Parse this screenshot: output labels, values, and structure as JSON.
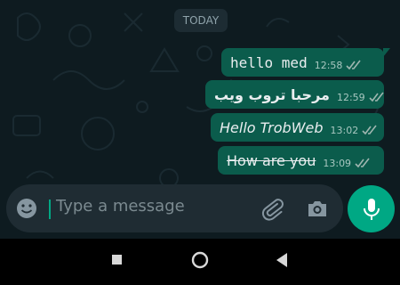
{
  "chat": {
    "date_chip": "TODAY",
    "messages": [
      {
        "text": "hello med",
        "time": "12:58",
        "status": "read-ticks-icon"
      },
      {
        "text": "مرحبا تروب ويب",
        "time": "12:59",
        "status": "read-ticks-icon"
      },
      {
        "text": "Hello TrobWeb",
        "time": "13:02",
        "status": "read-ticks-icon"
      },
      {
        "text": "How are you",
        "time": "13:09",
        "status": "read-ticks-icon"
      }
    ]
  },
  "composer": {
    "placeholder": "Type a message",
    "icons": [
      "emoji-icon",
      "paperclip-icon",
      "camera-icon",
      "microphone-icon"
    ]
  },
  "navbar": {
    "icons": [
      "recents-square-icon",
      "home-circle-icon",
      "back-triangle-icon"
    ]
  },
  "colors": {
    "chat_background": "#0e1b20",
    "outgoing_bubble": "#0b5c4c",
    "accent": "#00a884",
    "composer_background": "#1f2c33"
  }
}
